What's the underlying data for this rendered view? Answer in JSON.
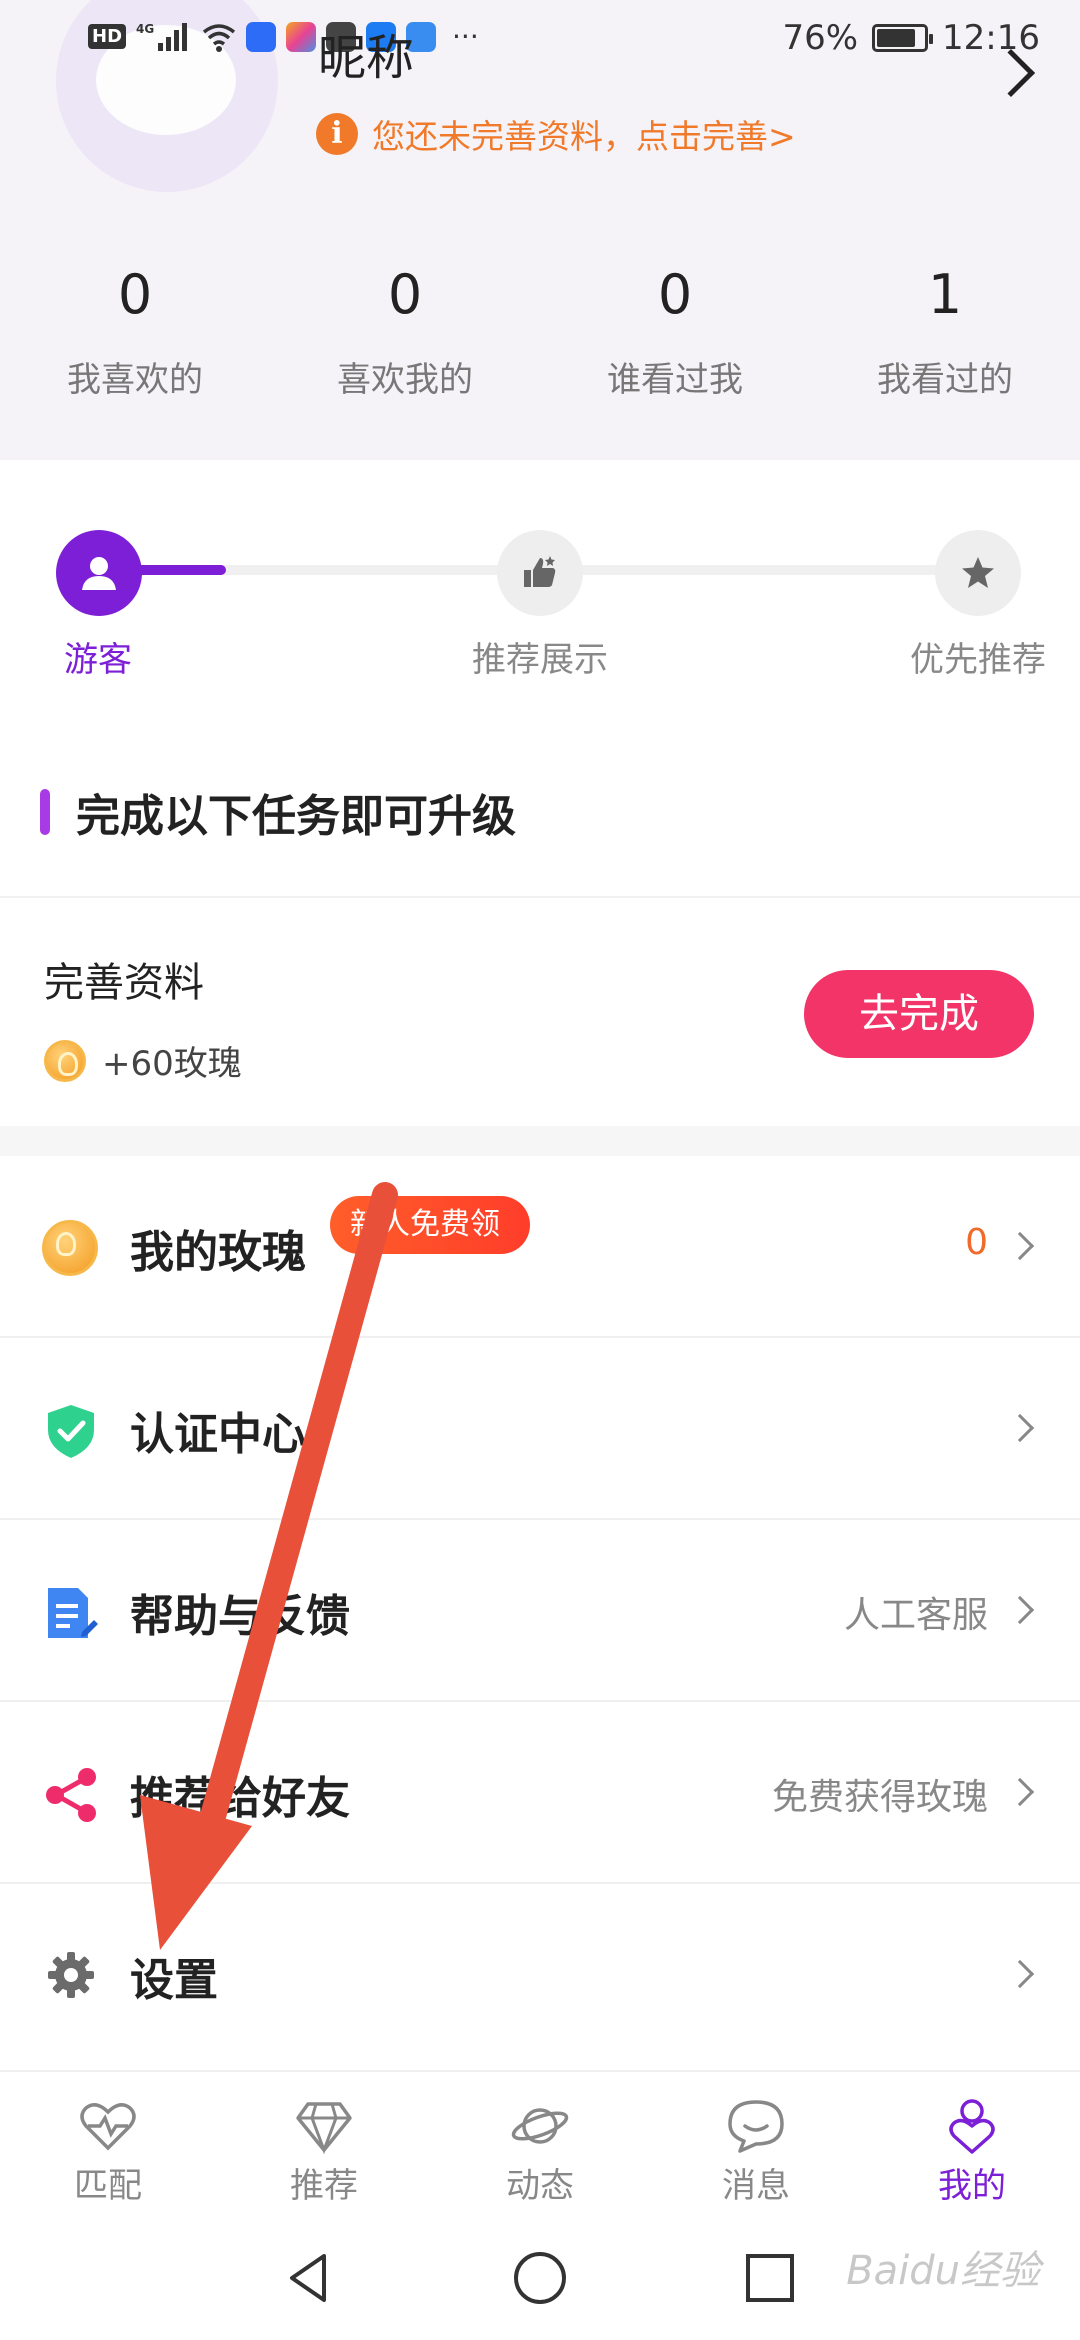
{
  "status_bar": {
    "network_chip": "HD",
    "signal_label": "4G",
    "battery_percent": "76%",
    "time": "12:16",
    "overflow": "···"
  },
  "profile": {
    "nickname": "昵称",
    "hint": "您还未完善资料，点击完善>"
  },
  "stats": [
    {
      "value": "0",
      "label": "我喜欢的"
    },
    {
      "value": "0",
      "label": "喜欢我的"
    },
    {
      "value": "0",
      "label": "谁看过我"
    },
    {
      "value": "1",
      "label": "我看过的"
    }
  ],
  "levels": {
    "progress": 0.14,
    "items": [
      {
        "label": "游客",
        "icon": "user-icon",
        "active": true
      },
      {
        "label": "推荐展示",
        "icon": "thumbs-up-icon",
        "active": false
      },
      {
        "label": "优先推荐",
        "icon": "star-icon",
        "active": false
      }
    ]
  },
  "tasks": {
    "title": "完成以下任务即可升级",
    "items": [
      {
        "title": "完善资料",
        "reward": "+60玫瑰",
        "button": "去完成"
      }
    ]
  },
  "menu": [
    {
      "label": "我的玫瑰",
      "badge": "新人免费领",
      "value": "0",
      "icon": "rose-coin-icon",
      "value_color": "#f06a2a"
    },
    {
      "label": "认证中心",
      "badge": "",
      "value": "",
      "icon": "shield-check-icon"
    },
    {
      "label": "帮助与反馈",
      "badge": "",
      "value": "人工客服",
      "icon": "document-edit-icon"
    },
    {
      "label": "推荐给好友",
      "badge": "",
      "value": "免费获得玫瑰",
      "icon": "share-icon"
    },
    {
      "label": "设置",
      "badge": "",
      "value": "",
      "icon": "gear-icon"
    }
  ],
  "bottom_nav": [
    {
      "label": "匹配",
      "icon": "heartbeat-icon",
      "active": false
    },
    {
      "label": "推荐",
      "icon": "diamond-icon",
      "active": false
    },
    {
      "label": "动态",
      "icon": "planet-icon",
      "active": false
    },
    {
      "label": "消息",
      "icon": "chat-bubble-icon",
      "active": false
    },
    {
      "label": "我的",
      "icon": "profile-heart-icon",
      "active": true
    }
  ],
  "colors": {
    "accent": "#7c1fd6",
    "warning": "#f07a2a",
    "cta": "#f23468",
    "annotation": "#e8503a"
  },
  "watermark": "Baidu经验"
}
